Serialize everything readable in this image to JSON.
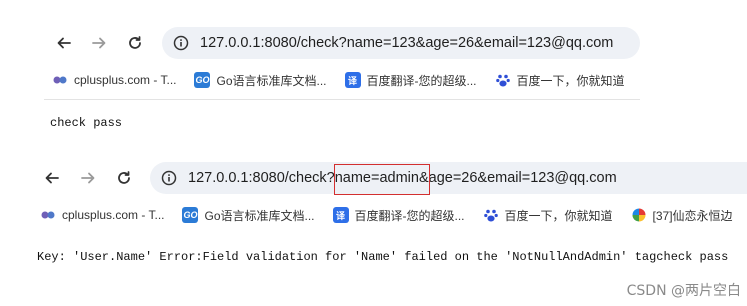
{
  "browser1": {
    "url": "127.0.0.1:8080/check?name=123&age=26&email=123@qq.com",
    "bookmarks": [
      {
        "label": "cplusplus.com - T...",
        "icon": "cplusplus-icon"
      },
      {
        "label": "Go语言标准库文档...",
        "icon": "go-icon"
      },
      {
        "label": "百度翻译-您的超级...",
        "icon": "baidu-fanyi-icon"
      },
      {
        "label": "百度一下，你就知道",
        "icon": "baidu-paw-icon"
      }
    ],
    "page_text": "check pass"
  },
  "browser2": {
    "url": "127.0.0.1:8080/check?name=admin&age=26&email=123@qq.com",
    "bookmarks": [
      {
        "label": "cplusplus.com - T...",
        "icon": "cplusplus-icon"
      },
      {
        "label": "Go语言标准库文档...",
        "icon": "go-icon"
      },
      {
        "label": "百度翻译-您的超级...",
        "icon": "baidu-fanyi-icon"
      },
      {
        "label": "百度一下，你就知道",
        "icon": "baidu-paw-icon"
      },
      {
        "label": "[37]仙恋永恒边",
        "icon": "game-icon"
      }
    ],
    "page_text": "Key: 'User.Name' Error:Field validation for 'Name' failed on the 'NotNullAndAdmin' tagcheck pass"
  },
  "watermark": "CSDN @两片空白",
  "colors": {
    "omnibox_bg": "#eef1f6",
    "highlight": "#d32f2f",
    "go_fav": "#2b7bd6",
    "fanyi_fav": "#2e6fe8"
  }
}
